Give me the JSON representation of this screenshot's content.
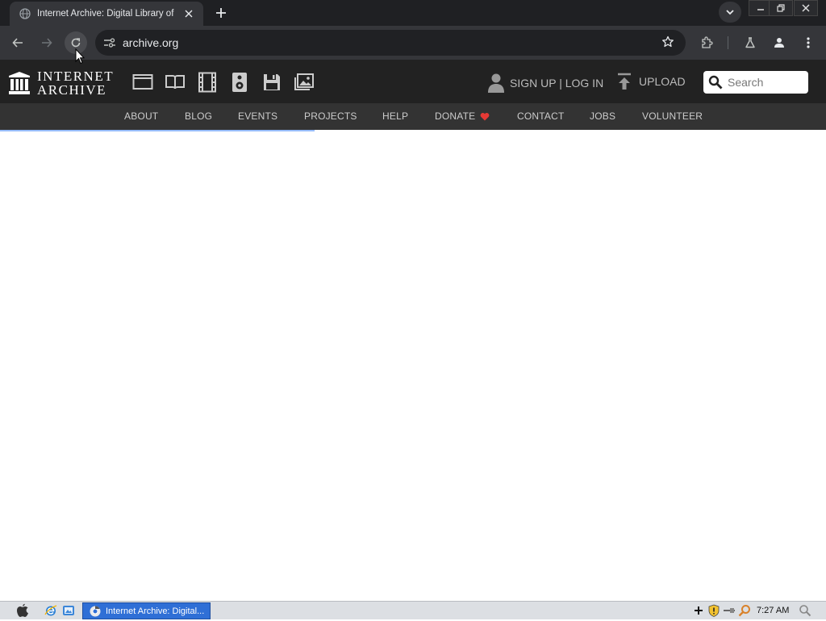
{
  "browser": {
    "tab": {
      "title": "Internet Archive: Digital Library of",
      "favicon": "globe-icon"
    },
    "address": "archive.org",
    "icons": [
      "back-icon",
      "forward-icon",
      "reload-icon",
      "site-info-icon",
      "star-icon",
      "extensions-icon",
      "labs-icon",
      "profile-icon",
      "menu-icon"
    ]
  },
  "ia": {
    "logo": {
      "line1": "INTERNET",
      "line2": "ARCHIVE"
    },
    "media_icons": [
      "web-icon",
      "texts-icon",
      "video-icon",
      "audio-icon",
      "software-icon",
      "images-icon"
    ],
    "account_label": "SIGN UP | LOG IN",
    "upload_label": "UPLOAD",
    "search_placeholder": "Search",
    "nav": [
      "ABOUT",
      "BLOG",
      "EVENTS",
      "PROJECTS",
      "HELP",
      "DONATE",
      "CONTACT",
      "JOBS",
      "VOLUNTEER"
    ]
  },
  "taskbar": {
    "task_title": "Internet Archive: Digital...",
    "clock": "7:27 AM"
  },
  "colors": {
    "chrome_dark": "#1f2023",
    "toolbar": "#35363a",
    "ia_header": "#222222",
    "ia_nav": "#333333",
    "donate_heart": "#e53935",
    "task_active": "#2f6fd6"
  }
}
